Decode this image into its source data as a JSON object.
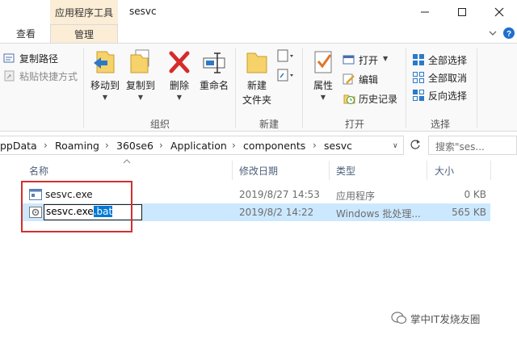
{
  "window": {
    "context_tab_header": "应用程序工具",
    "title": "sesvc"
  },
  "tabs": {
    "view": "查看",
    "manage": "管理"
  },
  "ribbon": {
    "clipboard": {
      "copy_path": "复制路径",
      "paste_shortcut": "粘贴快捷方式"
    },
    "organize": {
      "label": "组织",
      "move_to": "移动到",
      "copy_to": "复制到",
      "delete": "删除",
      "rename": "重命名"
    },
    "new": {
      "label": "新建",
      "new_folder_line1": "新建",
      "new_folder_line2": "文件夹"
    },
    "open": {
      "label": "打开",
      "properties": "属性",
      "open": "打开",
      "edit": "编辑",
      "history": "历史记录"
    },
    "select": {
      "label": "选择",
      "select_all": "全部选择",
      "select_none": "全部取消",
      "invert": "反向选择"
    }
  },
  "address": {
    "crumbs": [
      "ppData",
      "Roaming",
      "360se6",
      "Application",
      "components",
      "sesvc"
    ],
    "search_placeholder": "搜索\"ses..."
  },
  "list": {
    "columns": {
      "name": "名称",
      "modified": "修改日期",
      "type": "类型",
      "size": "大小"
    },
    "rows": [
      {
        "name": "sesvc.exe",
        "modified": "2019/8/27 14:53",
        "type": "应用程序",
        "size": "0 KB"
      },
      {
        "name": "",
        "modified": "2019/8/2 14:22",
        "type": "Windows 批处理...",
        "size": "565 KB"
      }
    ],
    "rename": {
      "base": "sesvc.exe",
      "selected_ext": ".bat"
    }
  },
  "watermark": {
    "text": "掌中IT发烧友圈"
  },
  "colors": {
    "context_tab": "#fbedd6",
    "selected_row": "#cce8ff",
    "highlight_frame": "#d32f2f",
    "text_selection": "#0078d7"
  }
}
